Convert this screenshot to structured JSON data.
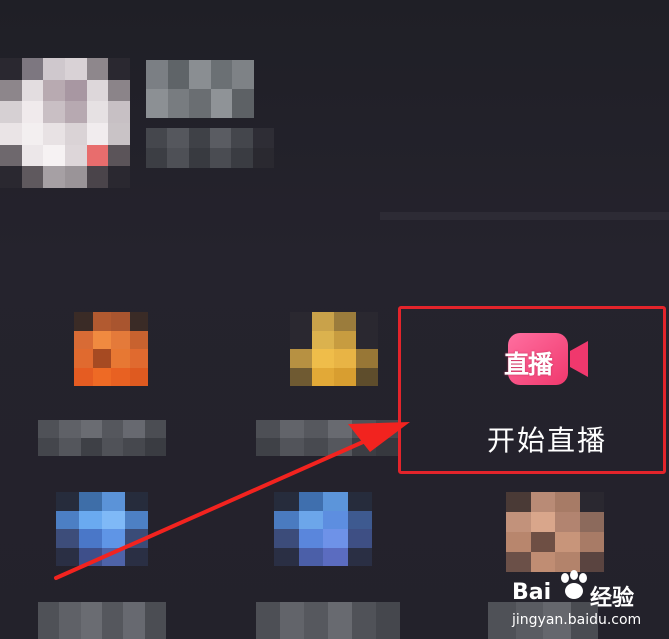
{
  "live_tile": {
    "icon_text": "直播",
    "label": "开始直播"
  },
  "watermark": {
    "brand": "Bai",
    "brand_suffix": "经验",
    "url": "jingyan.baidu.com"
  },
  "colors": {
    "highlight_border": "#e3242b",
    "arrow": "#f2231f",
    "live_icon_pink": "#f2457a",
    "background": "#23222b"
  },
  "icons": {
    "live": "video-camera-icon"
  }
}
